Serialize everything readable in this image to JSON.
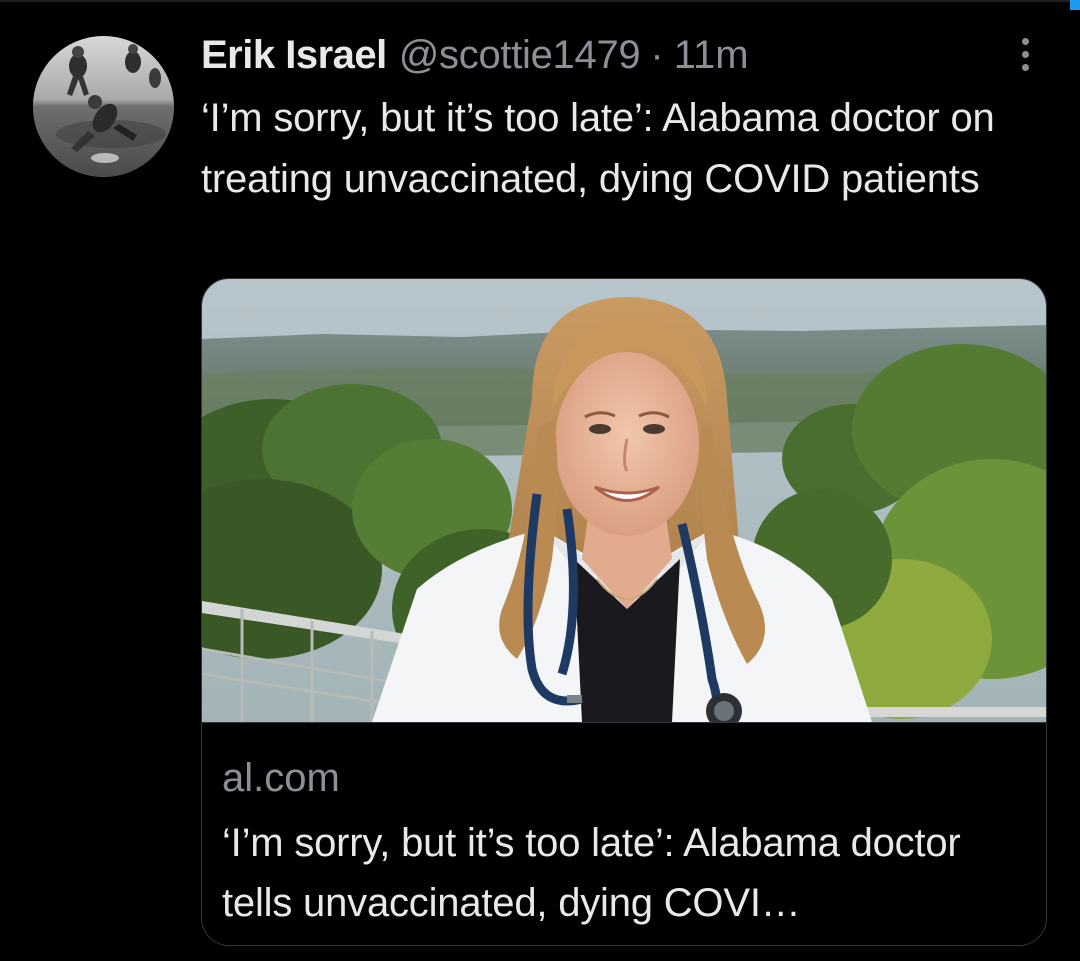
{
  "tweet": {
    "author_name": "Erik Israel",
    "author_handle": "@scottie1479",
    "separator": "·",
    "time": "11m",
    "text": "‘I’m sorry, but it’s too late’: Alabama doctor on treating unvaccinated, dying COVID patients",
    "more_icon": "more-vertical-icon"
  },
  "card": {
    "domain": "al.com",
    "title": "‘I’m sorry, but it’s too late’: Alabama doctor tells unvaccinated, dying COVI…"
  },
  "colors": {
    "background": "#000000",
    "primary_text": "#e7e9ea",
    "secondary_text": "#8b9096",
    "border": "#33373c",
    "accent": "#1d9bf0"
  }
}
